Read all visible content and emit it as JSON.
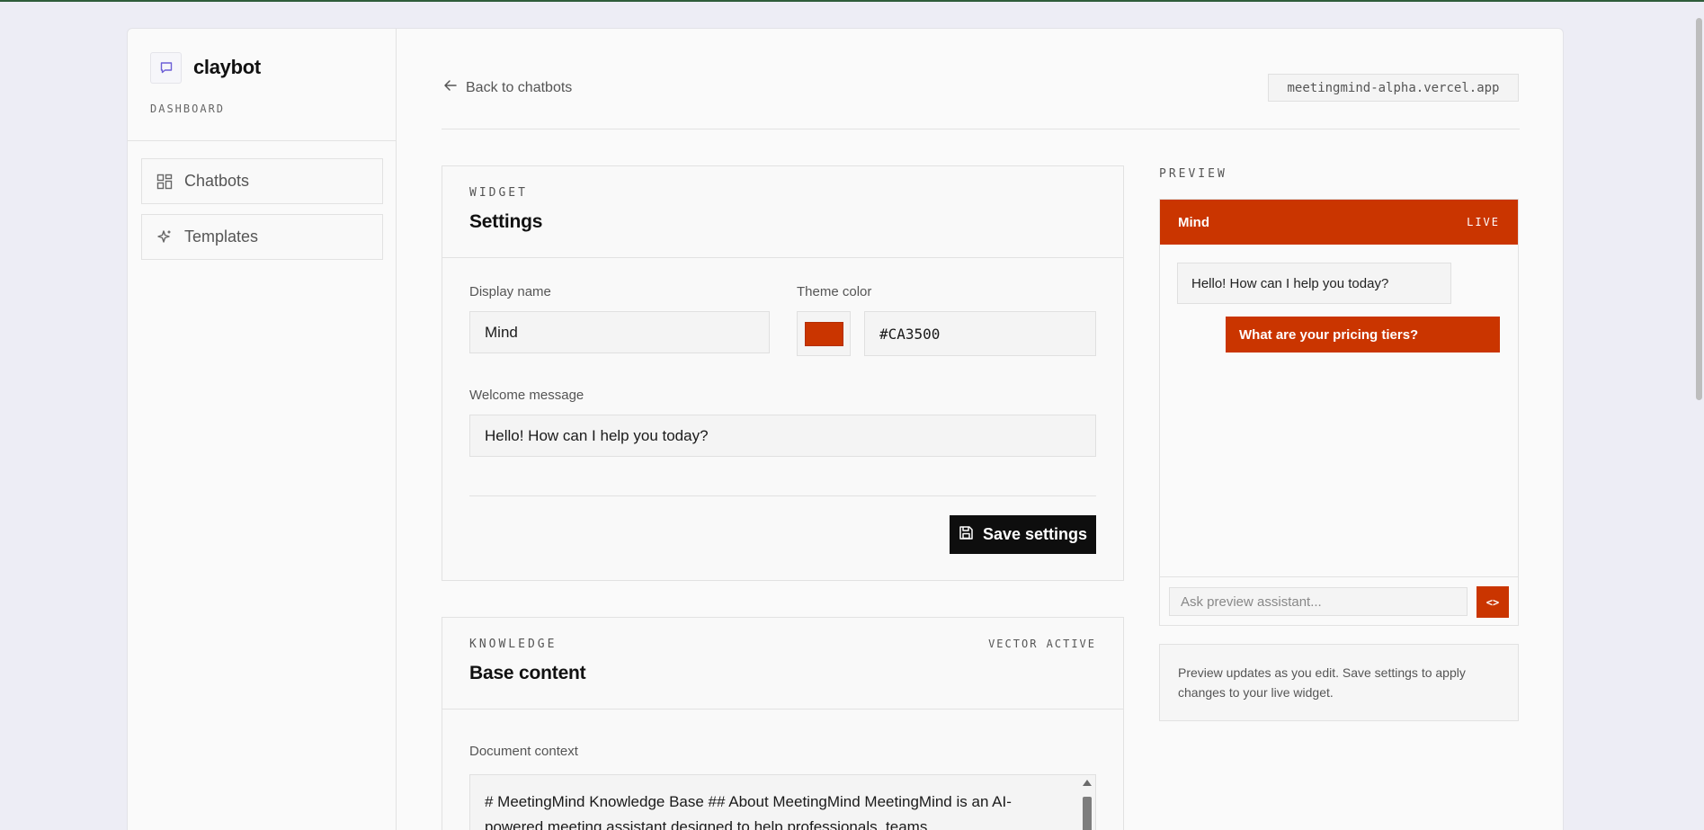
{
  "brand": {
    "name": "claybot",
    "subtitle": "DASHBOARD"
  },
  "sidebar": {
    "items": [
      {
        "label": "Chatbots",
        "icon": "grid-icon"
      },
      {
        "label": "Templates",
        "icon": "sparkles-icon"
      }
    ]
  },
  "header": {
    "back_label": "Back to chatbots",
    "domain": "meetingmind-alpha.vercel.app"
  },
  "widget_card": {
    "eyebrow": "WIDGET",
    "title": "Settings",
    "display_name_label": "Display name",
    "display_name_value": "Mind",
    "theme_color_label": "Theme color",
    "theme_color_value": "#CA3500",
    "welcome_label": "Welcome message",
    "welcome_value": "Hello! How can I help you today?",
    "save_label": "Save settings"
  },
  "knowledge_card": {
    "eyebrow": "KNOWLEDGE",
    "status": "VECTOR ACTIVE",
    "title": "Base content",
    "document_label": "Document context",
    "document_value": "# MeetingMind Knowledge Base ## About MeetingMind MeetingMind is an AI-powered meeting assistant designed to help professionals, teams,"
  },
  "preview": {
    "label": "PREVIEW",
    "bot_name": "Mind",
    "status": "LIVE",
    "messages": [
      {
        "role": "bot",
        "text": "Hello! How can I help you today?"
      },
      {
        "role": "user",
        "text": "What are your pricing tiers?"
      }
    ],
    "input_placeholder": "Ask preview assistant...",
    "send_label": "<>",
    "note": "Preview updates as you edit. Save settings to apply changes to your live widget."
  },
  "colors": {
    "accent": "#CA3500",
    "background": "#EDEDF5",
    "button_dark": "#0E0E0E"
  }
}
